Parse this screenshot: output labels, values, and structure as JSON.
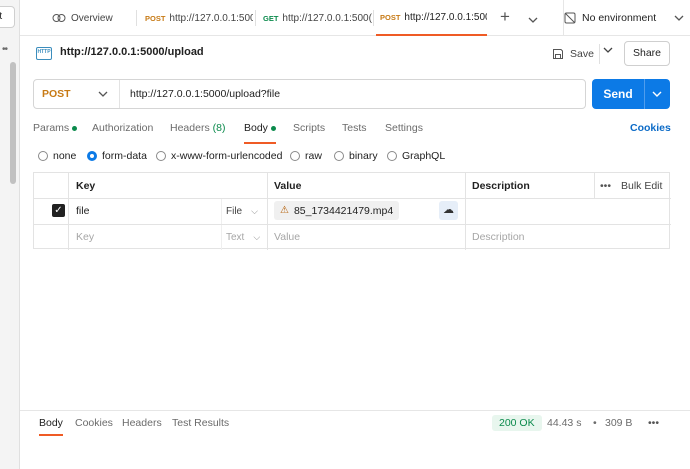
{
  "rail": {
    "chip_label": "rt",
    "dots": "••"
  },
  "tabs": [
    {
      "label": "Overview"
    },
    {
      "method": "POST",
      "url": "http://127.0.0.1:500("
    },
    {
      "method": "GET",
      "url": "http://127.0.0.1:500("
    },
    {
      "method": "POST",
      "url": "http://127.0.0.1:500"
    }
  ],
  "environment": {
    "label": "No environment"
  },
  "request": {
    "title": "http://127.0.0.1:5000/upload",
    "save_label": "Save",
    "share_label": "Share",
    "method": "POST",
    "url": "http://127.0.0.1:5000/upload?file",
    "send_label": "Send"
  },
  "request_tabs": [
    {
      "label": "Params"
    },
    {
      "label": "Authorization"
    },
    {
      "label": "Headers",
      "count": "(8)"
    },
    {
      "label": "Body"
    },
    {
      "label": "Scripts"
    },
    {
      "label": "Tests"
    },
    {
      "label": "Settings"
    }
  ],
  "cookies_label": "Cookies",
  "body_types": [
    {
      "label": "none",
      "selected": false
    },
    {
      "label": "form-data",
      "selected": true
    },
    {
      "label": "x-www-form-urlencoded",
      "selected": false
    },
    {
      "label": "raw",
      "selected": false
    },
    {
      "label": "binary",
      "selected": false
    },
    {
      "label": "GraphQL",
      "selected": false
    }
  ],
  "table": {
    "headers": {
      "key": "Key",
      "value": "Value",
      "description": "Description",
      "bulk_edit": "Bulk Edit"
    },
    "rows": [
      {
        "checked": true,
        "key": "file",
        "type": "File",
        "value": "85_1734421479.mp4",
        "description": ""
      }
    ],
    "empty_row": {
      "key_placeholder": "Key",
      "type": "Text",
      "value_placeholder": "Value",
      "description_placeholder": "Description"
    }
  },
  "response": {
    "tabs": [
      {
        "label": "Body"
      },
      {
        "label": "Cookies"
      },
      {
        "label": "Headers"
      },
      {
        "label": "Test Results"
      }
    ],
    "status": "200 OK",
    "time": "44.43 s",
    "size": "309 B"
  }
}
